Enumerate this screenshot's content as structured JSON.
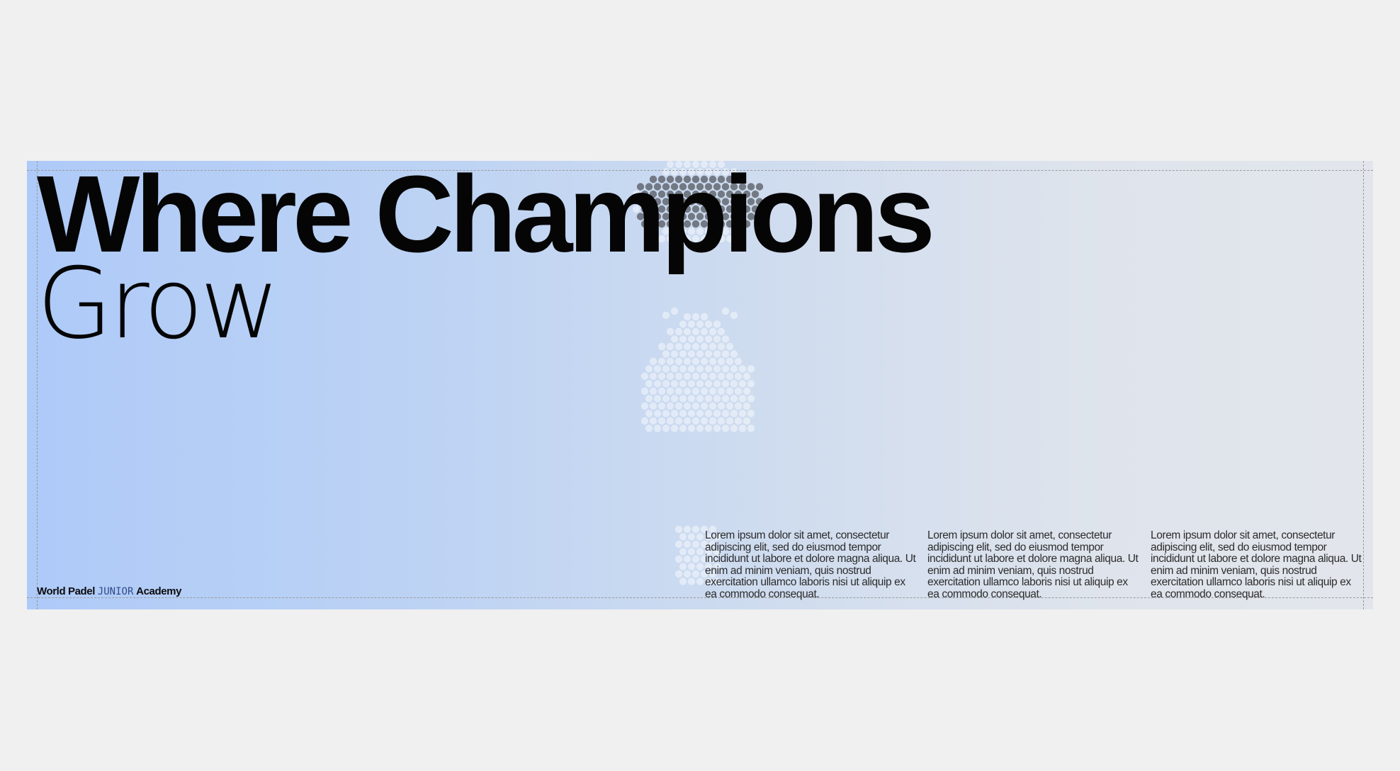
{
  "headline": {
    "line1": "Where Champions",
    "line2": "Grow"
  },
  "brand": {
    "part1": "World Padel",
    "part2": "JUNIOR",
    "part3": "Academy"
  },
  "columns": [
    "Lorem ipsum dolor sit amet, consectetur adipiscing elit, sed do eiusmod tempor incididunt ut labore et dolore magna aliqua. Ut enim ad minim veniam, quis nostrud exercitation ullamco laboris nisi ut aliquip ex ea commodo consequat.",
    "Lorem ipsum dolor sit amet, consectetur adipiscing elit, sed do eiusmod tempor incididunt ut labore et dolore magna aliqua. Ut enim ad minim veniam, quis nostrud exercitation ullamco laboris nisi ut aliquip ex ea commodo consequat.",
    "Lorem ipsum dolor sit amet, consectetur adipiscing elit, sed do eiusmod tempor incididunt ut labore et dolore magna aliqua. Ut enim ad minim veniam, quis nostrud exercitation ullamco laboris nisi ut aliquip ex ea commodo consequat."
  ],
  "colors": {
    "page_background": "#f0f0f0",
    "gradient_start": "#aecaf8",
    "gradient_end": "#e2e6ec",
    "text": "#050505",
    "guide_lines": "#9a9a9a"
  },
  "motif": {
    "name": "dotted-shuttlecock-motif"
  }
}
